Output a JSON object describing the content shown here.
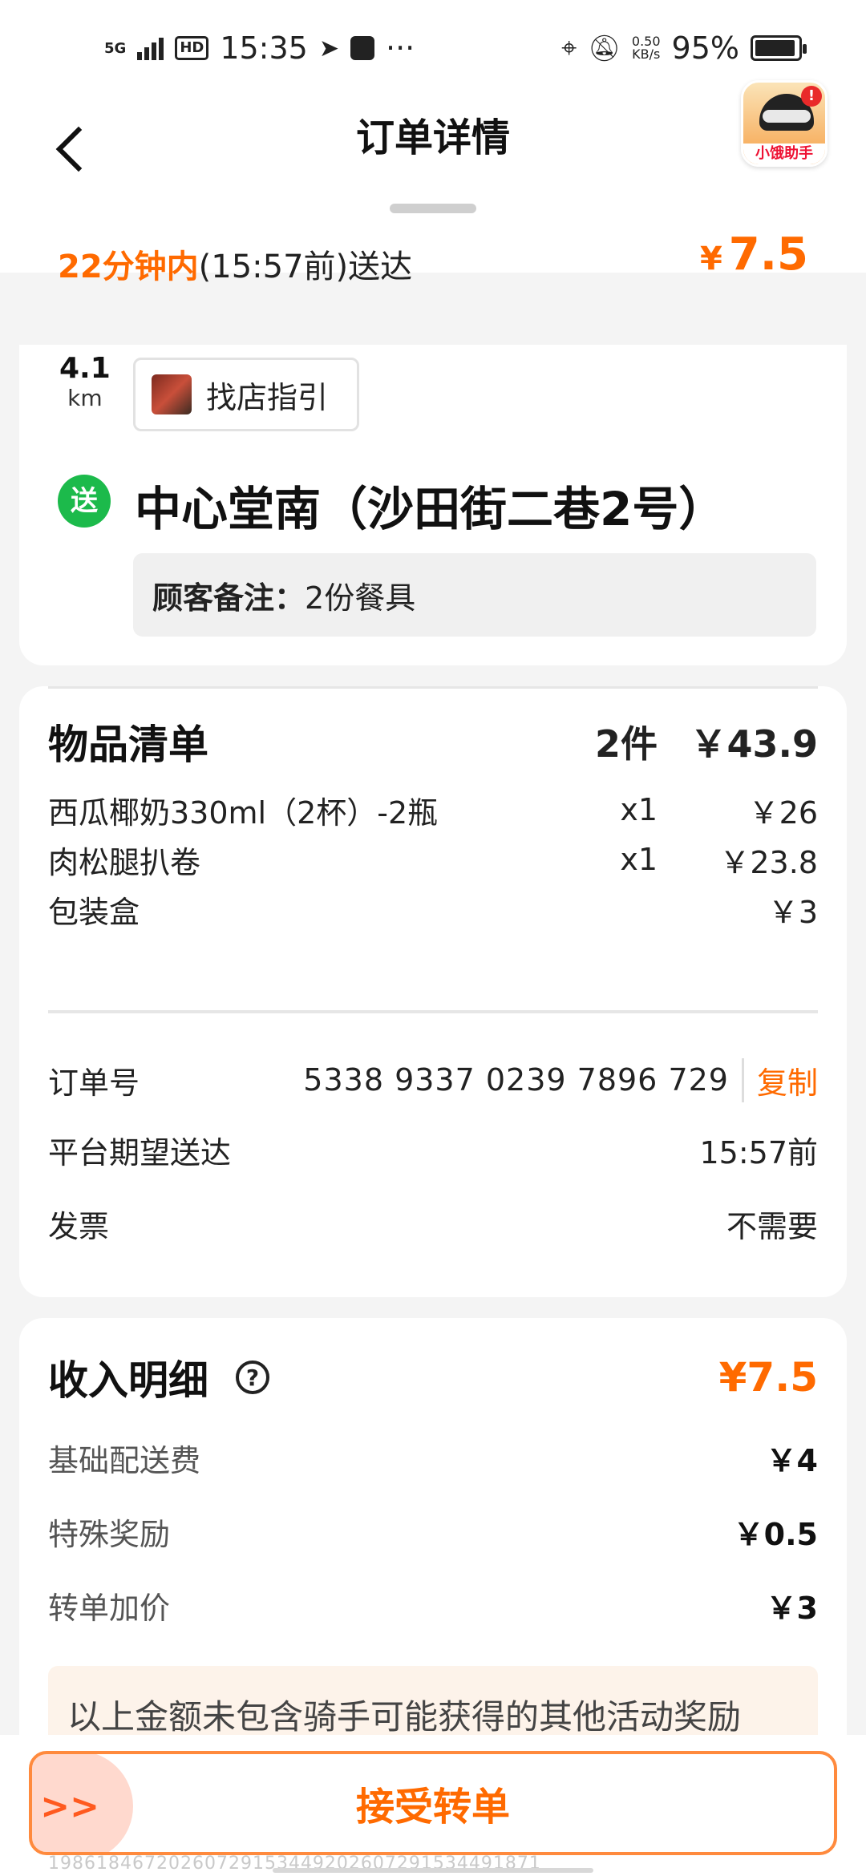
{
  "status_bar": {
    "network": "5G",
    "hd": "HD",
    "time": "15:35",
    "more": "···",
    "speed_value": "0.50",
    "speed_unit": "KB/s",
    "battery": "95%"
  },
  "nav": {
    "title": "订单详情",
    "assistant_label": "小饿助手",
    "assistant_badge": "!"
  },
  "eta": {
    "strong": "22分钟内",
    "rest": "(15:57前)送达",
    "price_symbol": "¥",
    "price": "7.5"
  },
  "store": {
    "distance": "4.1",
    "distance_unit": "km",
    "guide_label": "找店指引"
  },
  "delivery": {
    "badge": "送",
    "address": "中心堂南（沙田街二巷2号）",
    "note_label": "顾客备注：",
    "note_value": "2份餐具"
  },
  "items": {
    "title": "物品清单",
    "count": "2件",
    "total": "￥43.9",
    "rows": [
      {
        "name": "西瓜椰奶330ml（2杯）-2瓶",
        "qty": "x1",
        "price": "￥26"
      },
      {
        "name": "肉松腿扒卷",
        "qty": "x1",
        "price": "￥23.8"
      },
      {
        "name": "包装盒",
        "qty": "",
        "price": "￥3"
      }
    ]
  },
  "order": {
    "number_label": "订单号",
    "number": "5338 9337 0239 7896 729",
    "copy": "复制",
    "eta_label": "平台期望送达",
    "eta_value": "15:57前",
    "invoice_label": "发票",
    "invoice_value": "不需要"
  },
  "income": {
    "title": "收入明细",
    "help": "?",
    "total": "¥7.5",
    "rows": [
      {
        "label": "基础配送费",
        "value": "￥4"
      },
      {
        "label": "特殊奖励",
        "value": "￥0.5"
      },
      {
        "label": "转单加价",
        "value": "￥3"
      }
    ],
    "notice": "以上金额未包含骑手可能获得的其他活动奖励"
  },
  "action": {
    "swipe_glyph": ">>",
    "accept": "接受转单"
  },
  "watermark": "19861846720260729153449202607291534491871"
}
